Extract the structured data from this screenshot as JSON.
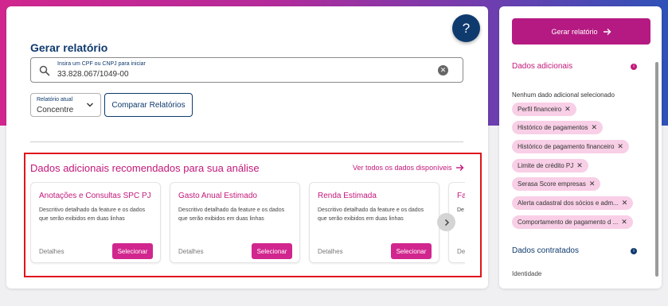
{
  "help": {
    "label": "?"
  },
  "report": {
    "title": "Gerar relatório",
    "search_label": "Insira um CPF ou CNPJ para iniciar",
    "search_value": "33.828.067/1049-00",
    "select_label": "Relatório atual",
    "select_value": "Concentre",
    "compare_button": "Comparar Relatórios"
  },
  "recommended": {
    "title": "Dados adicionais recomendados para sua análise",
    "see_all": "Ver todos os dados disponíveis",
    "cards": [
      {
        "title": "Anotações e Consultas SPC PJ",
        "description": "Descritivo detalhado da feature e os dados que serão exibidos em duas linhas",
        "details": "Detalhes",
        "select": "Selecionar"
      },
      {
        "title": "Gasto Anual Estimado",
        "description": "Descritivo detalhado da feature e os dados que serão exibidos em duas linhas",
        "details": "Detalhes",
        "select": "Selecionar"
      },
      {
        "title": "Renda Estimada",
        "description": "Descritivo detalhado da feature e os dados que serão exibidos em duas linhas",
        "details": "Detalhes",
        "select": "Selecionar"
      },
      {
        "title": "Fa",
        "description": "De da",
        "details": "De",
        "select": ""
      }
    ]
  },
  "sidebar": {
    "generate_button": "Gerar relatório",
    "additional_title": "Dados adicionais",
    "additional_note": "Nenhum dado adicional selecionado",
    "chips": [
      "Perfil financeiro",
      "Histórico de pagamentos",
      "Histórico de pagamento financeiro",
      "Limite de crédito PJ",
      "Serasa Score empresas",
      "Alerta cadastral dos sócios e adm...",
      "Comportamento de pagamento d ..."
    ],
    "contracted_title": "Dados contratados",
    "footer_item": "Identidade"
  },
  "colors": {
    "brand_pink": "#d1268e",
    "brand_navy": "#0f3a6e",
    "chip_bg": "#f8cfe6",
    "highlight_red": "#e0151b"
  },
  "icons": {
    "help": "question-mark",
    "search": "magnifier",
    "clear": "x-circle",
    "chevron": "chevron-down",
    "arrow": "arrow-right",
    "next": "chevron-right",
    "info": "info-dot"
  }
}
